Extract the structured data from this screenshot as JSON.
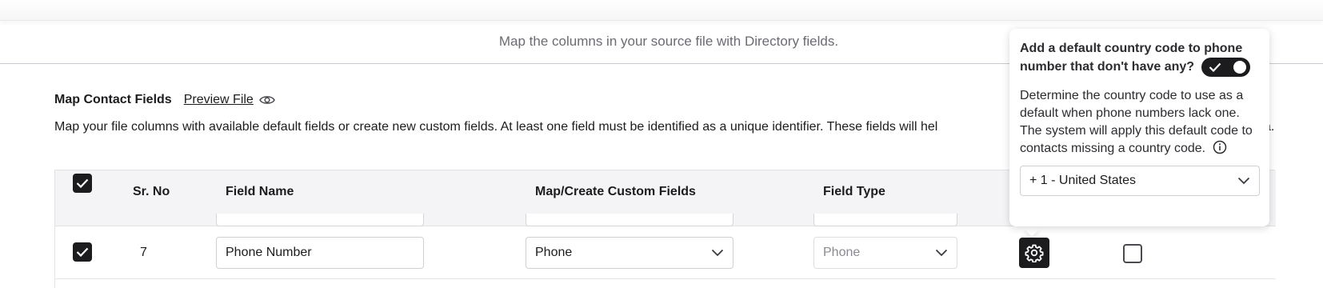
{
  "header": {
    "subtitle": "Map the columns in your source file with Directory fields."
  },
  "section": {
    "title": "Map Contact Fields",
    "preview_label": "Preview File",
    "description": "Map your file columns with available default fields or create new custom fields. At least one field must be identified as a unique identifier. These fields will hel",
    "description_tail": "a."
  },
  "table": {
    "headers": {
      "sr_no": "Sr. No",
      "field_name": "Field Name",
      "map_create": "Map/Create Custom Fields",
      "field_type": "Field Type"
    },
    "header_checkbox_checked": true,
    "rows": [
      {
        "checked": true,
        "sr_no": "7",
        "field_name": "Phone Number",
        "mapped_field": "Phone",
        "field_type": "Phone",
        "field_type_disabled": true,
        "unique_identifier_checked": false
      }
    ]
  },
  "popover": {
    "title": "Add a default country code to phone number that don't have any?",
    "toggle_on": true,
    "body": "Determine the country code to use as a default when phone numbers lack one. The system will apply this default code to contacts missing a country code.",
    "country_code_value": "+ 1 - United States"
  },
  "icons": {
    "preview": "eye-icon",
    "settings": "gear-icon",
    "info": "info-icon",
    "dropdown": "chevron-down-icon",
    "check": "check-icon"
  },
  "colors": {
    "primary_dark": "#1c1c1e",
    "muted_text": "#6b6b73",
    "header_bg": "#f4f4f6"
  }
}
